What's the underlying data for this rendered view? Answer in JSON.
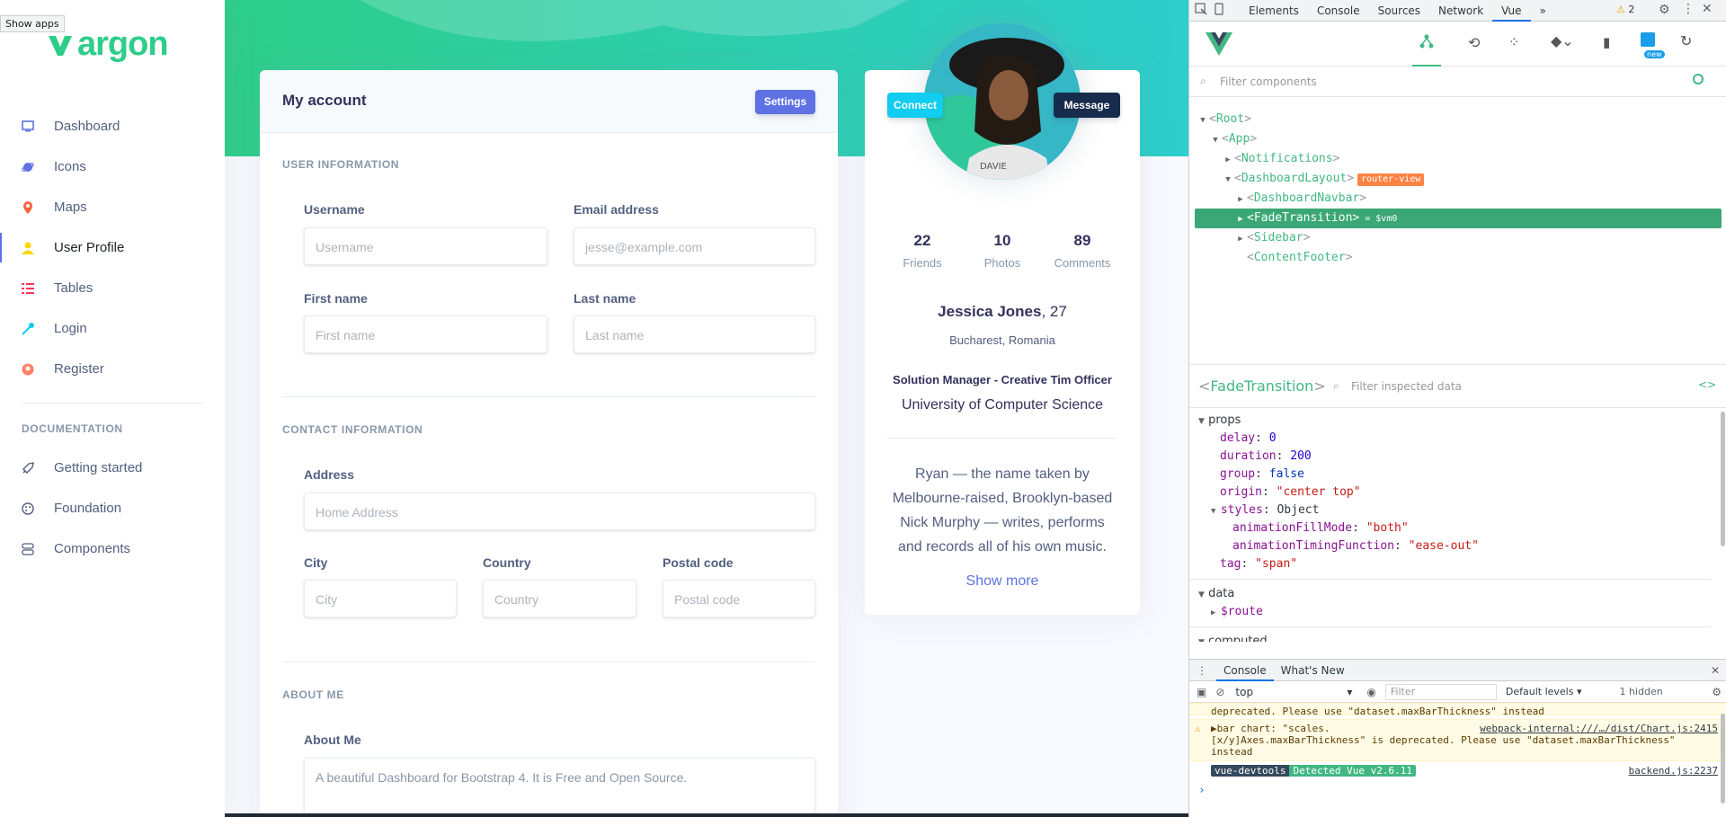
{
  "browser": {
    "tooltip": "Show apps"
  },
  "sidebar": {
    "logo": "argon",
    "items": [
      {
        "label": "Dashboard",
        "icon": "tv-icon",
        "color": "#5e72e4"
      },
      {
        "label": "Icons",
        "icon": "planet-icon",
        "color": "#5e72e4"
      },
      {
        "label": "Maps",
        "icon": "pin-icon",
        "color": "#fb6340"
      },
      {
        "label": "User Profile",
        "icon": "user-icon",
        "color": "#ffd600",
        "active": true
      },
      {
        "label": "Tables",
        "icon": "bullet-list-icon",
        "color": "#f5365c"
      },
      {
        "label": "Login",
        "icon": "key-icon",
        "color": "#11cdef"
      },
      {
        "label": "Register",
        "icon": "circle-user-icon",
        "color": "#fb6340"
      }
    ],
    "doc_heading": "DOCUMENTATION",
    "doc_items": [
      {
        "label": "Getting started",
        "icon": "spaceship-icon"
      },
      {
        "label": "Foundation",
        "icon": "palette-icon"
      },
      {
        "label": "Components",
        "icon": "ui-icon"
      }
    ]
  },
  "account": {
    "title": "My account",
    "settings_label": "Settings",
    "user_info_heading": "USER INFORMATION",
    "username_label": "Username",
    "username_placeholder": "Username",
    "email_label": "Email address",
    "email_placeholder": "jesse@example.com",
    "firstname_label": "First name",
    "firstname_placeholder": "First name",
    "lastname_label": "Last name",
    "lastname_placeholder": "Last name",
    "contact_heading": "CONTACT INFORMATION",
    "address_label": "Address",
    "address_placeholder": "Home Address",
    "city_label": "City",
    "city_placeholder": "City",
    "country_label": "Country",
    "country_placeholder": "Country",
    "postal_label": "Postal code",
    "postal_placeholder": "Postal code",
    "about_heading": "ABOUT ME",
    "about_label": "About Me",
    "about_value": "A beautiful Dashboard for Bootstrap 4. It is Free and Open Source."
  },
  "profile": {
    "connect_label": "Connect",
    "message_label": "Message",
    "stats": [
      {
        "value": "22",
        "label": "Friends"
      },
      {
        "value": "10",
        "label": "Photos"
      },
      {
        "value": "89",
        "label": "Comments"
      }
    ],
    "name": "Jessica Jones",
    "age": ", 27",
    "location": "Bucharest, Romania",
    "job": "Solution Manager - Creative Tim Officer",
    "university": "University of Computer Science",
    "bio": "Ryan — the name taken by Melbourne-raised, Brooklyn-based Nick Murphy — writes, performs and records all of his own music.",
    "show_more": "Show more"
  },
  "devtools": {
    "tabs": [
      "Elements",
      "Console",
      "Sources",
      "Network",
      "Vue"
    ],
    "selected_tab": "Vue",
    "warning_count": "2",
    "new_badge": "new",
    "filter_components_placeholder": "Filter components",
    "tree": [
      {
        "depth": 0,
        "arrow": "▼",
        "name": "Root"
      },
      {
        "depth": 1,
        "arrow": "▼",
        "name": "App"
      },
      {
        "depth": 2,
        "arrow": "▶",
        "name": "Notifications"
      },
      {
        "depth": 2,
        "arrow": "▼",
        "name": "DashboardLayout",
        "badge": "router-view"
      },
      {
        "depth": 3,
        "arrow": "▶",
        "name": "DashboardNavbar"
      },
      {
        "depth": 3,
        "arrow": "▶",
        "name": "FadeTransition",
        "selected": true,
        "suffix": "= $vm0"
      },
      {
        "depth": 3,
        "arrow": "▶",
        "name": "Sidebar"
      },
      {
        "depth": 3,
        "arrow": "",
        "name": "ContentFooter"
      }
    ],
    "inspected_name": "FadeTransition",
    "filter_data_placeholder": "Filter inspected data",
    "props_heading": "props",
    "props": [
      {
        "key": "delay",
        "value": "0",
        "type": "num"
      },
      {
        "key": "duration",
        "value": "200",
        "type": "num"
      },
      {
        "key": "group",
        "value": "false",
        "type": "bool"
      },
      {
        "key": "origin",
        "value": "\"center top\"",
        "type": "str"
      }
    ],
    "styles_key": "styles",
    "styles_type": "Object",
    "styles": [
      {
        "key": "animationFillMode",
        "value": "\"both\""
      },
      {
        "key": "animationTimingFunction",
        "value": "\"ease-out\""
      }
    ],
    "tag_key": "tag",
    "tag_value": "\"span\"",
    "data_heading": "data",
    "route_key": "$route",
    "computed_heading": "computed",
    "console": {
      "tabs": [
        "Console",
        "What's New"
      ],
      "context": "top",
      "filter_placeholder": "Filter",
      "levels": "Default levels ▾",
      "hidden": "1 hidden",
      "msg1": "deprecated. Please use \"dataset.maxBarThickness\" instead",
      "msg2_head": "▶bar chart: \"scales.",
      "msg2_link": "webpack-internal:///…/dist/Chart.js:2415",
      "msg2_body": "[x/y]Axes.maxBarThickness\" is deprecated. Please use \"dataset.maxBarThickness\"",
      "msg2_tail": "instead",
      "badge1": "vue-devtools",
      "badge2": "Detected Vue v2.6.11",
      "backend_link": "backend.js:2237",
      "prompt": "›"
    }
  }
}
